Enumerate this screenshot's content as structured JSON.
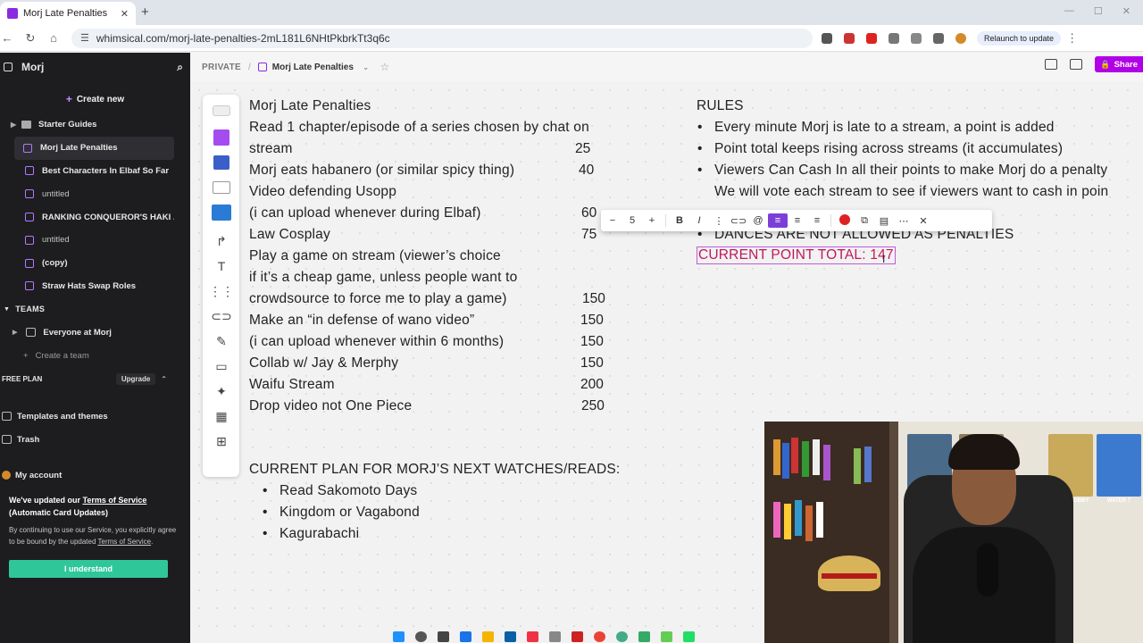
{
  "browser": {
    "tab_title": "Morj Late Penalties",
    "url": "whimsical.com/morj-late-penalties-2mL181L6NHtPkbrkTt3q6c",
    "relaunch_label": "Relaunch to update"
  },
  "sidebar": {
    "workspace_name": "Morj",
    "create_new": "Create new",
    "items": [
      {
        "label": "Starter Guides",
        "kind": "folder"
      },
      {
        "label": "Morj Late Penalties",
        "kind": "doc",
        "active": true
      },
      {
        "label": "Best Characters In Elbaf So Far",
        "kind": "doc"
      },
      {
        "label": "untitled",
        "kind": "doc"
      },
      {
        "label": "RANKING CONQUEROR'S HAKI ...",
        "kind": "doc"
      },
      {
        "label": "untitled",
        "kind": "doc"
      },
      {
        "label": "(copy)",
        "kind": "doc"
      },
      {
        "label": "Straw Hats Swap Roles",
        "kind": "doc"
      }
    ],
    "teams_header": "TEAMS",
    "team": "Everyone at Morj",
    "create_team": "Create a team",
    "free_plan": "FREE PLAN",
    "upgrade": "Upgrade",
    "templates": "Templates and themes",
    "trash": "Trash",
    "account": "My account",
    "terms": {
      "title_pre": "We've updated our ",
      "title_link": "Terms of Service",
      "title_post": "(Automatic Card Updates)",
      "body_pre": "By continuing to use our Service, you explicitly agree to be bound by the updated ",
      "body_link": "Terms of Service",
      "body_post": ".",
      "button": "I understand"
    }
  },
  "topbar": {
    "private": "PRIVATE",
    "separator": "/",
    "doc_title": "Morj Late Penalties",
    "share": "Share"
  },
  "format_bar": {
    "minus": "−",
    "size": "5",
    "plus": "+",
    "bold": "B",
    "italic": "I",
    "text_color": "#d32222",
    "close": "✕"
  },
  "doc": {
    "title": "Morj Late Penalties",
    "lines": [
      {
        "text": "Read 1 chapter/episode of a series chosen by chat on"
      },
      {
        "text": "stream",
        "points": "25"
      },
      {
        "text": "Morj eats habanero (or similar spicy thing)",
        "points": "40"
      },
      {
        "text": "Video defending Usopp"
      },
      {
        "text": "(i can upload whenever during Elbaf)",
        "points": "60"
      },
      {
        "text": "Law Cosplay",
        "points": "75"
      },
      {
        "text": "Play a game on stream (viewer’s choice"
      },
      {
        "text": "if it’s a cheap game, unless people want to"
      },
      {
        "text": "crowdsource to force me to play a game)",
        "points": "150"
      },
      {
        "text": "Make an “in defense of wano video”",
        "points": "150"
      },
      {
        "text": "(i can upload whenever within 6 months)",
        "points": "150"
      },
      {
        "text": "Collab w/ Jay & Merphy",
        "points": "150"
      },
      {
        "text": "Waifu Stream",
        "points": "200"
      },
      {
        "text": "Drop video not One Piece",
        "points": "250"
      }
    ],
    "plan_title": "CURRENT PLAN FOR MORJ’S NEXT WATCHES/READS:",
    "plan_items": [
      "Read Sakomoto Days",
      "Kingdom or Vagabond",
      "Kagurabachi"
    ],
    "rules_title": "RULES",
    "rules": [
      "Every minute Morj is late to a stream, a point is added",
      "Point total keeps rising across streams (it accumulates)",
      "Viewers Can Cash In all their points to make Morj do a penalty",
      "We will vote each stream to see if viewers want to cash in poin",
      "DANCES ARE NOT ALLOWED AS PENALTIES"
    ],
    "total": "CURRENT POINT TOTAL: 147"
  },
  "webcam": {
    "poster_1": "ENIES LOBBY",
    "poster_2": "WATER 7"
  }
}
